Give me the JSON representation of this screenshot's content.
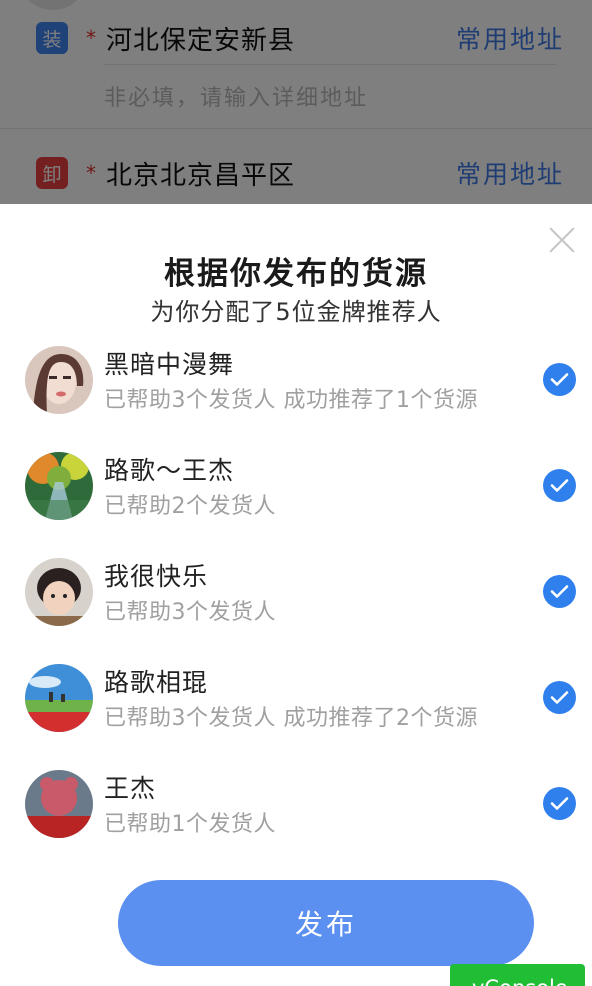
{
  "background_form": {
    "load": {
      "tag": "装",
      "address": "河北保定安新县",
      "link": "常用地址",
      "detail_placeholder": "非必填，请输入详细地址"
    },
    "unload": {
      "tag": "卸",
      "address": "北京北京昌平区",
      "link": "常用地址"
    },
    "required_mark": "*"
  },
  "sheet": {
    "title": "根据你发布的货源",
    "subtitle": "为你分配了5位金牌推荐人",
    "recommenders": [
      {
        "name": "黑暗中漫舞",
        "stats": "已帮助3个发货人 成功推荐了1个货源",
        "checked": true,
        "avatar": "woman-portrait-avatar"
      },
      {
        "name": "路歌～王杰",
        "stats": "已帮助2个发货人",
        "checked": true,
        "avatar": "forest-path-avatar"
      },
      {
        "name": "我很快乐",
        "stats": "已帮助3个发货人",
        "checked": true,
        "avatar": "baby-photo-avatar"
      },
      {
        "name": "路歌相琨",
        "stats": "已帮助3个发货人 成功推荐了2个货源",
        "checked": true,
        "avatar": "grassland-sky-avatar"
      },
      {
        "name": "王杰",
        "stats": "已帮助1个发货人",
        "checked": true,
        "avatar": "red-bear-avatar"
      }
    ],
    "publish_label": "发布"
  },
  "debug": {
    "vconsole_label": "vConsole"
  },
  "colors": {
    "accent": "#2f80ed",
    "publish_button": "#5b8ff0",
    "link": "#3e7be6",
    "required": "#e0302c",
    "vconsole": "#1fbe35"
  }
}
